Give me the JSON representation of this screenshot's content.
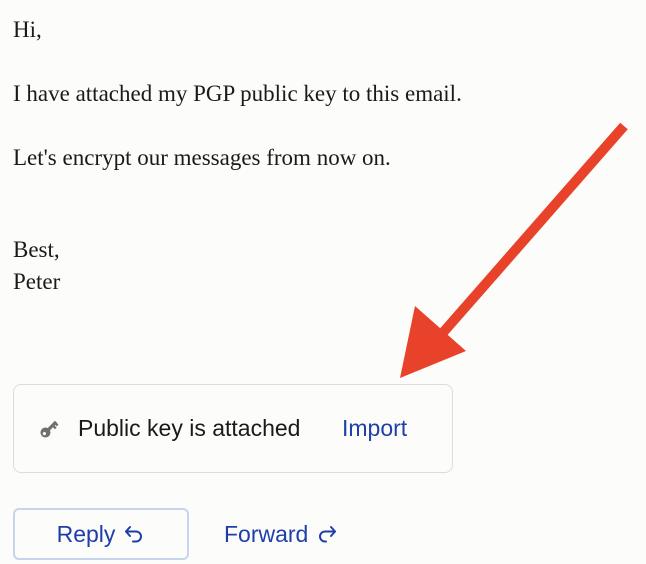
{
  "email": {
    "greeting": "Hi,",
    "line1": "I have attached my PGP public key to this email.",
    "line2": "Let's encrypt our messages from now on.",
    "signoff": "Best,",
    "sender_name": "Peter"
  },
  "attachment": {
    "icon": "key-icon",
    "label": "Public key is attached",
    "action_label": "Import"
  },
  "actions": {
    "reply_label": "Reply",
    "reply_icon": "reply-arrow-icon",
    "forward_label": "Forward",
    "forward_icon": "forward-arrow-icon"
  },
  "annotation": {
    "arrow_color": "#e8432a",
    "arrow_icon": "red-arrow-annotation"
  },
  "colors": {
    "link": "#1f3fa8",
    "text": "#1a1a1a",
    "background": "#fcfcfa"
  }
}
